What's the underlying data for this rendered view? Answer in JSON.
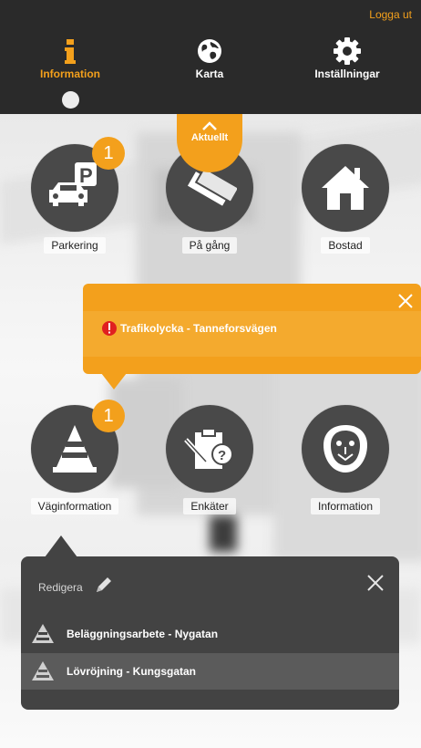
{
  "header": {
    "logout_label": "Logga ut",
    "nav": [
      {
        "label": "Information",
        "icon": "info-icon",
        "active": true
      },
      {
        "label": "Karta",
        "icon": "globe-icon"
      },
      {
        "label": "Inställningar",
        "icon": "gear-icon"
      }
    ]
  },
  "aktuellt": {
    "label": "Aktuellt",
    "icon": "chevron-up-icon"
  },
  "tiles": [
    {
      "label": "Parkering",
      "icon": "parking-car-icon",
      "badge": "1"
    },
    {
      "label": "På gång",
      "icon": "tickets-icon"
    },
    {
      "label": "Bostad",
      "icon": "house-icon"
    },
    {
      "label": "Väginformation",
      "icon": "traffic-cone-icon",
      "badge": "1"
    },
    {
      "label": "Enkäter",
      "icon": "survey-clipboard-icon"
    },
    {
      "label": "Information",
      "icon": "lion-crest-icon"
    }
  ],
  "alert_popup": {
    "item": "Trafikolycka - Tanneforsvägen",
    "icon": "exclamation-icon",
    "close_icon": "close-icon"
  },
  "road_popup": {
    "edit_label": "Redigera",
    "items": [
      "Beläggningsarbete - Nygatan",
      "Lövröjning - Kungsgatan"
    ]
  },
  "colors": {
    "accent": "#f3a01c",
    "header_bg": "#2a2a2a",
    "tile_circle": "#494949",
    "dark_popup": "#434343"
  }
}
